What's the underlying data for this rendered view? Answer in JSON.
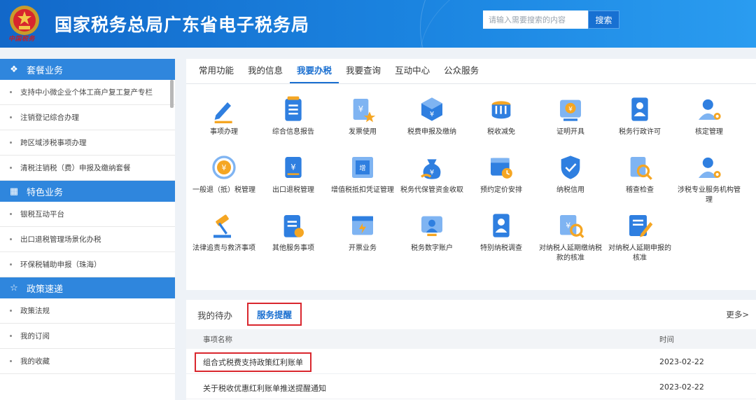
{
  "header": {
    "title": "国家税务总局广东省电子税务局",
    "emblem_text": "中国税务",
    "search_placeholder": "请输入需要搜索的内容",
    "search_button": "搜索"
  },
  "sidebar": {
    "sections": [
      {
        "title": "套餐业务",
        "icon": "layers-icon",
        "items": [
          "支持中小微企业个体工商户复工复产专栏",
          "注销登记综合办理",
          "跨区域涉税事项办理",
          "清税注销税（费）申报及缴纳套餐"
        ]
      },
      {
        "title": "特色业务",
        "icon": "grid-icon",
        "items": [
          "银税互动平台",
          "出口退税管理场景化办税",
          "环保税辅助申报（珠海）"
        ]
      },
      {
        "title": "政策速递",
        "icon": "star-icon",
        "items": [
          "政策法规",
          "我的订阅",
          "我的收藏"
        ]
      }
    ]
  },
  "main": {
    "tabs": [
      "常用功能",
      "我的信息",
      "我要办税",
      "我要查询",
      "互动中心",
      "公众服务"
    ],
    "active_tab": 2,
    "services": [
      {
        "label": "事项办理",
        "icon": "pen-icon"
      },
      {
        "label": "综合信息报告",
        "icon": "document-icon"
      },
      {
        "label": "发票使用",
        "icon": "invoice-icon"
      },
      {
        "label": "税费申报及缴纳",
        "icon": "declare-icon"
      },
      {
        "label": "税收减免",
        "icon": "coins-icon"
      },
      {
        "label": "证明开具",
        "icon": "certificate-icon"
      },
      {
        "label": "税务行政许可",
        "icon": "license-icon"
      },
      {
        "label": "核定管理",
        "icon": "user-gear-icon"
      },
      {
        "label": "一般退（抵）税管理",
        "icon": "refund-icon"
      },
      {
        "label": "出口退税管理",
        "icon": "export-refund-icon"
      },
      {
        "label": "增值税抵扣凭证管理",
        "icon": "vat-ticket-icon"
      },
      {
        "label": "税务代保管资金收取",
        "icon": "money-bag-icon"
      },
      {
        "label": "预约定价安排",
        "icon": "calendar-icon"
      },
      {
        "label": "纳税信用",
        "icon": "shield-check-icon"
      },
      {
        "label": "稽查检查",
        "icon": "inspect-icon"
      },
      {
        "label": "涉税专业服务机构管理",
        "icon": "agency-icon"
      },
      {
        "label": "法律追责与救济事项",
        "icon": "gavel-icon"
      },
      {
        "label": "其他服务事项",
        "icon": "clipboard-icon"
      },
      {
        "label": "开票业务",
        "icon": "issue-invoice-icon"
      },
      {
        "label": "税务数字账户",
        "icon": "digital-account-icon"
      },
      {
        "label": "特别纳税调查",
        "icon": "special-investigation-icon"
      },
      {
        "label": "对纳税人延期缴纳税款的核准",
        "icon": "deferred-payment-icon"
      },
      {
        "label": "对纳税人延期申报的核准",
        "icon": "deferred-declare-icon"
      }
    ]
  },
  "notices": {
    "tabs": [
      "我的待办",
      "服务提醒"
    ],
    "active_tab": 1,
    "more": "更多>",
    "columns": [
      "事项名称",
      "时间"
    ],
    "rows": [
      {
        "name": "组合式税费支持政策红利账单",
        "date": "2023-02-22",
        "highlighted": true
      },
      {
        "name": "关于税收优惠红利账单推送提醒通知",
        "date": "2023-02-22",
        "highlighted": false
      }
    ]
  },
  "colors": {
    "primary": "#2f86dd",
    "highlight_border": "#d9272e",
    "accent_orange": "#f5a623"
  }
}
